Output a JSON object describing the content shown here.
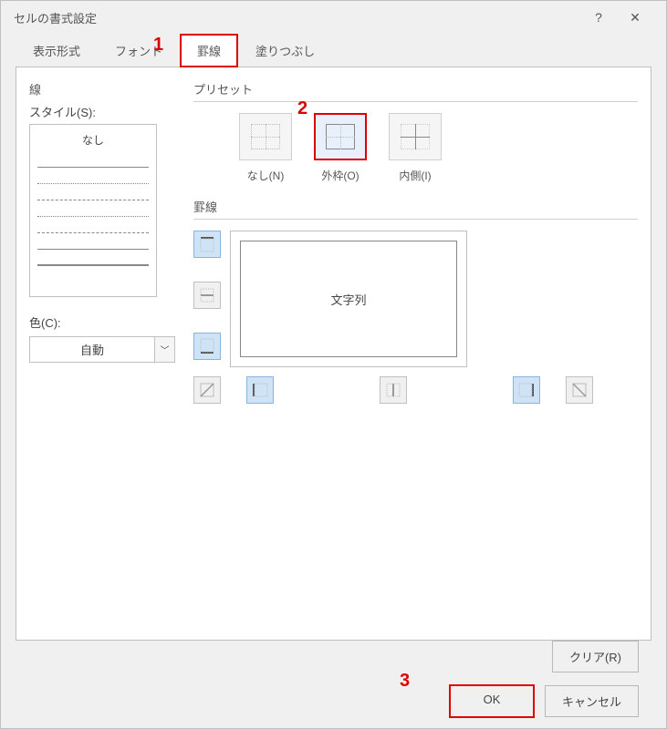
{
  "title": "セルの書式設定",
  "tabs": [
    "表示形式",
    "フォント",
    "罫線",
    "塗りつぶし"
  ],
  "activeTab": 2,
  "line": {
    "section": "線",
    "styleLabel": "スタイル(S):",
    "none": "なし",
    "colorLabel": "色(C):",
    "colorValue": "自動"
  },
  "preset": {
    "section": "プリセット",
    "items": [
      {
        "label": "なし(N)"
      },
      {
        "label": "外枠(O)"
      },
      {
        "label": "内側(I)"
      }
    ]
  },
  "border": {
    "section": "罫線",
    "previewText": "文字列"
  },
  "buttons": {
    "clear": "クリア(R)",
    "ok": "OK",
    "cancel": "キャンセル"
  },
  "annotations": {
    "a1": "1",
    "a2": "2",
    "a3": "3"
  }
}
